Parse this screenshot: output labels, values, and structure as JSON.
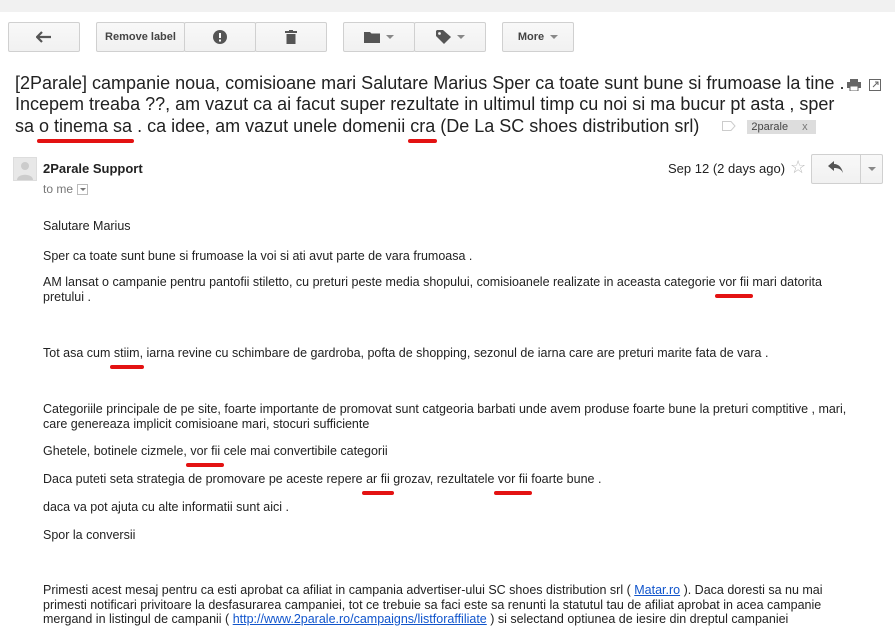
{
  "toolbar": {
    "back_icon": "arrow-back-icon",
    "remove_label": "Remove label",
    "report_icon": "report-spam-icon",
    "delete_icon": "trash-icon",
    "move_icon": "folder-icon",
    "labels_icon": "tag-icon",
    "more_label": "More"
  },
  "subject": {
    "part1": "[2Parale] campanie noua, comisioane mari Salutare Marius Sper ca toate sunt bune si frumoase la tine . Incepem treaba ??, am vazut ca ai facut super rezultate in ultimul timp cu noi si ma bucur pt asta , sper sa ",
    "u1": "o tinema sa",
    "part2": " . ca idee, am vazut unele domenii ",
    "u2": "cra",
    "part3": " (De La SC shoes distribution srl)",
    "label": "2parale",
    "label_close": "x"
  },
  "message": {
    "sender": "2Parale Support",
    "to": "to me",
    "date": "Sep 12 (2 days ago)",
    "star": "☆"
  },
  "body": {
    "greeting": "Salutare Marius",
    "line1": "Sper ca toate sunt bune si frumoase la voi si ati avut parte de vara frumoasa .",
    "p2a": "AM lansat o campanie pentru pantofii stiletto, cu preturi peste media shopului, comisioanele realizate in aceasta categorie ",
    "p2u": "vor fii",
    "p2b": " mari datorita pretului .",
    "p3a": "Tot asa cum ",
    "p3u": "stiim",
    "p3b": ", iarna revine cu schimbare de gardroba, pofta de shopping, sezonul de iarna care are preturi marite fata de vara .",
    "p4": "Categoriile principale de pe site, foarte importante de promovat sunt catgeoria barbati unde avem produse foarte bune la preturi comptitive , mari, care genereaza implicit comisioane mari, stocuri sufficiente",
    "p5a": "Ghetele, botinele cizmele, ",
    "p5u": "vor  fii",
    "p5b": " cele mai convertibile categorii",
    "p6a": "Daca puteti  seta strategia de promovare pe aceste repere ",
    "p6u1": "ar fii",
    "p6b": " grozav, rezultatele ",
    "p6u2": "vor fii",
    "p6c": " foarte bune .",
    "p7": "daca va pot ajuta cu alte informatii sunt aici .",
    "p8": "Spor la conversii",
    "footer_a": "Primesti acest mesaj pentru ca esti aprobat ca afiliat in campania advertiser-ului SC shoes distribution srl ( ",
    "footer_link1": "Matar.ro",
    "footer_b": " ). Daca doresti sa nu mai primesti notificari privitoare la desfasurarea campaniei, tot ce trebuie sa faci este sa renunti la statutul tau de afiliat aprobat in acea campanie mergand in listingul de campanii ( ",
    "footer_link2": "http://www.2parale.ro/campaigns/listforaffiliate",
    "footer_c": " ) si selectand optiunea de iesire din dreptul campaniei"
  },
  "colors": {
    "underline_red": "#e31212",
    "link_blue": "#1155cc",
    "label_bg": "#dddddd"
  }
}
